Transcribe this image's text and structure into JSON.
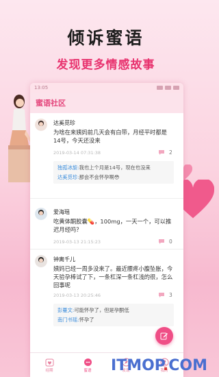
{
  "promo": {
    "title": "倾诉蜜语",
    "subtitle": "发现更多情感故事"
  },
  "status_bar": {
    "time": "13:05"
  },
  "app": {
    "title": "蜜语社区"
  },
  "posts": [
    {
      "username": "达奚觅珍",
      "content": "为啥在来姨妈前几天会有白带，月经平时都是14号，今天还没来",
      "timestamp": "2019-03-14 07:31:38",
      "comment_count": "2",
      "replies": [
        {
          "user": "独孤冰旋:",
          "text": "我也上个月是14号，现在也没来"
        },
        {
          "user": "达奚觅珍:",
          "text": "那会不会怀孕啊😳"
        }
      ]
    },
    {
      "username": "爱海瑶",
      "content": "吃黄体酮胶囊💊，100mg，一天一个，可以推迟月经吗？",
      "timestamp": "2019-03-13 21:15:23",
      "comment_count": "0"
    },
    {
      "username": "钟离千儿",
      "content": "姨妈已经一周多没来了。最近腰疼小腹坠胀，今天验孕棒试了下，一条杠深一条杠浅的很，怎么回事呢",
      "timestamp": "2019-03-13 20:25:46",
      "comment_count": "3",
      "replies": [
        {
          "user": "彭蔓文:",
          "text": "可能怀孕了，但是孕酮低"
        },
        {
          "user": "南门书瑶:",
          "text": "怀孕了"
        }
      ]
    }
  ],
  "tabs": [
    {
      "label": "经期",
      "icon": "calendar-heart-icon"
    },
    {
      "label": "蜜语",
      "icon": "chat-bubble-icon"
    },
    {
      "label": "发现",
      "icon": "discover-icon"
    },
    {
      "label": "我的",
      "icon": "user-icon"
    }
  ],
  "watermark": {
    "main": "ITMOP",
    "dot": ".",
    "tld": "COM"
  },
  "colors": {
    "accent": "#ef4e86",
    "subtitle": "#e8336f",
    "reply_user": "#3d8edc"
  }
}
